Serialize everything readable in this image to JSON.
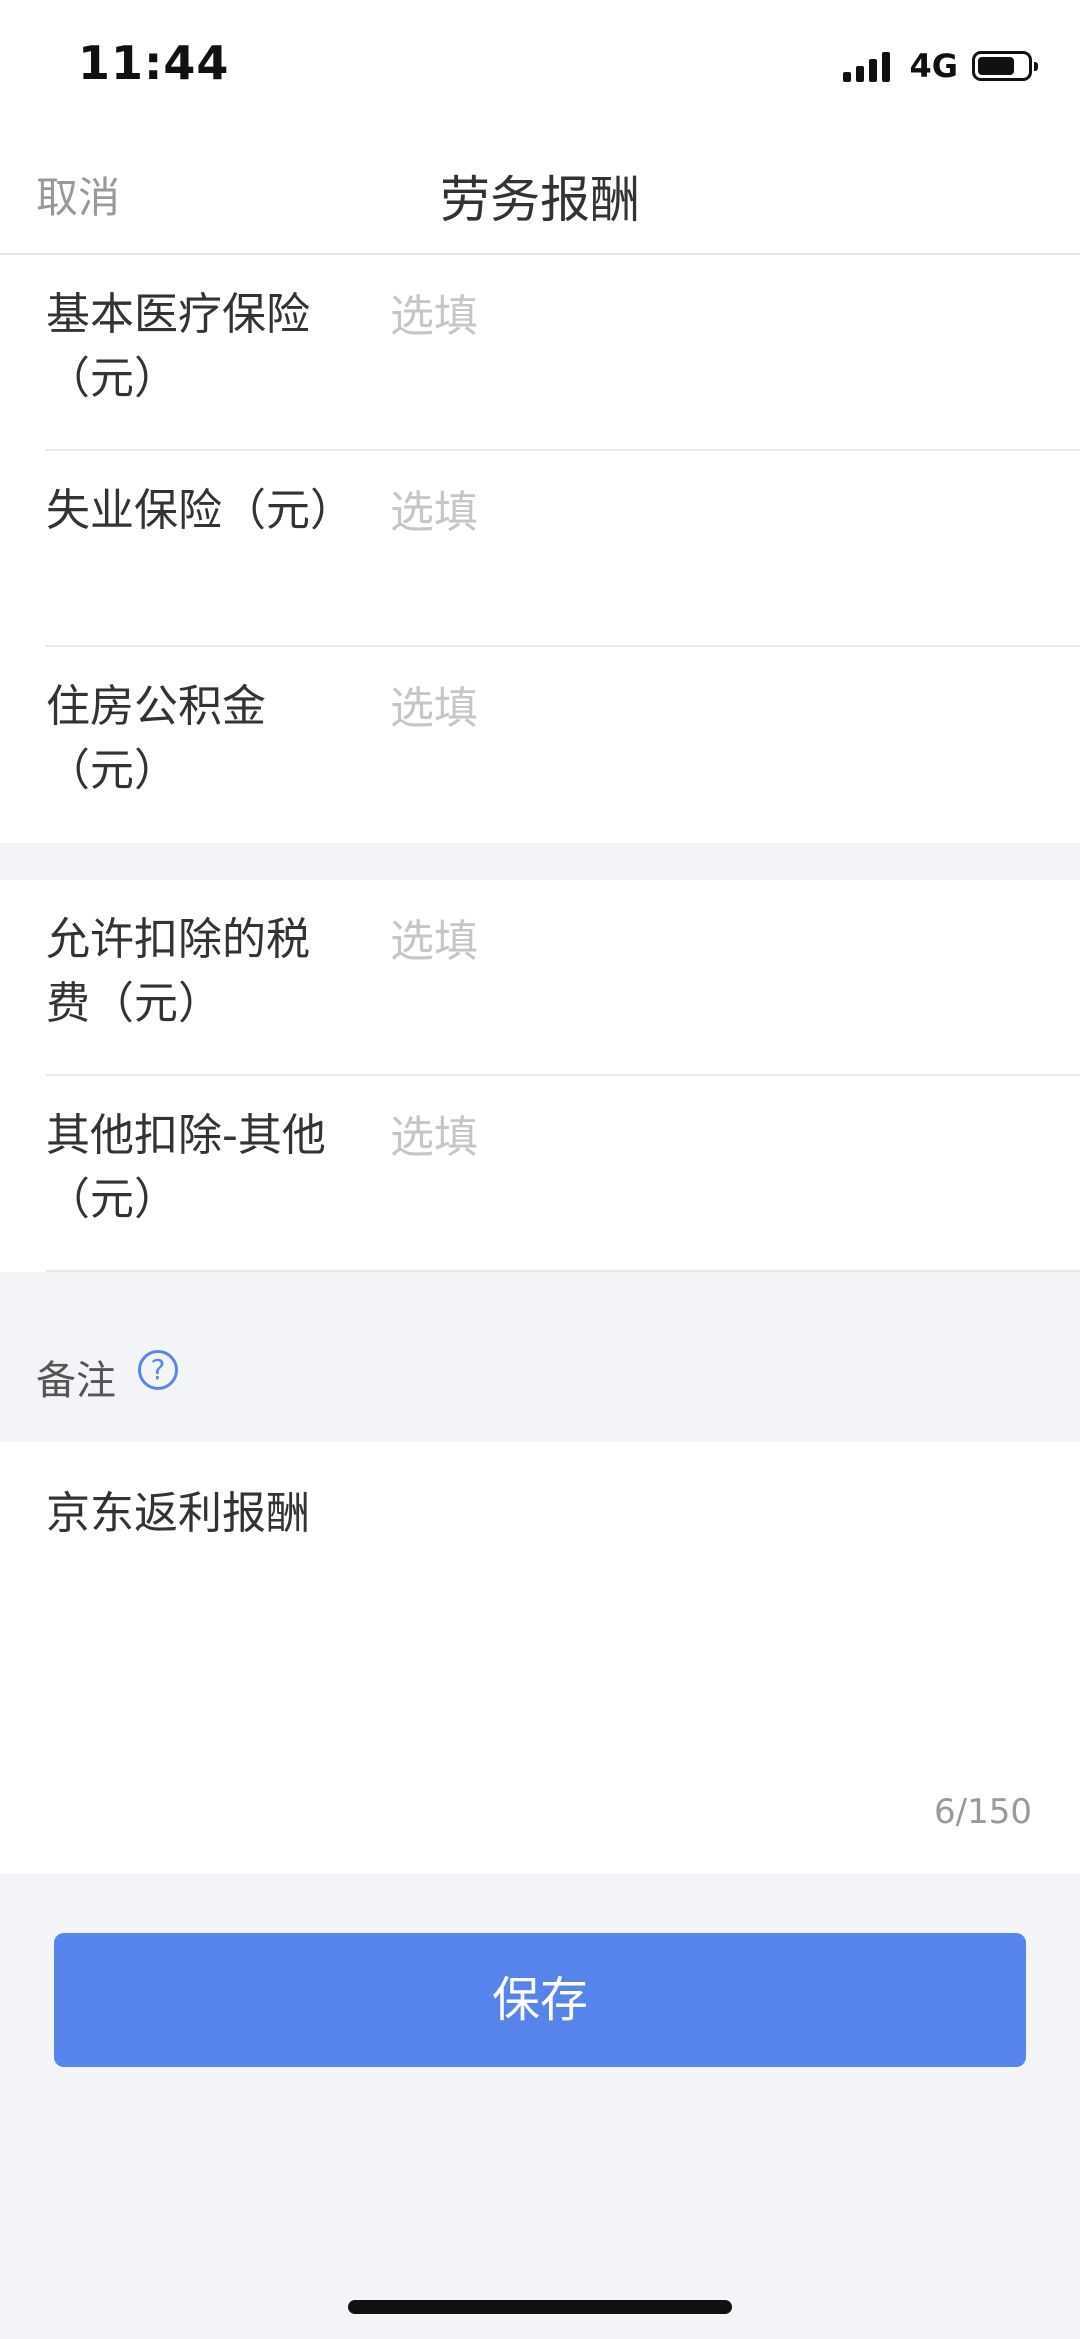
{
  "status_bar": {
    "time": "11:44",
    "network": "4G",
    "battery_level": 0.75,
    "signal_bars": 4
  },
  "nav": {
    "cancel_label": "取消",
    "title": "劳务报酬"
  },
  "form": {
    "group1": [
      {
        "label": "基本医疗保险（元）",
        "placeholder": "选填"
      },
      {
        "label": "失业保险（元）",
        "placeholder": "选填"
      },
      {
        "label": "住房公积金（元）",
        "placeholder": "选填"
      }
    ],
    "group2": [
      {
        "label": "允许扣除的税费（元）",
        "placeholder": "选填"
      },
      {
        "label": "其他扣除-其他（元）",
        "placeholder": "选填"
      }
    ]
  },
  "remark": {
    "label": "备注",
    "help_icon": "question-circle-icon",
    "help_glyph": "?",
    "value": "京东返利报酬",
    "char_count": "6/150"
  },
  "actions": {
    "save_label": "保存"
  },
  "colors": {
    "accent": "#5784ea",
    "background": "#f3f4f8",
    "placeholder": "#c6c6c6"
  }
}
